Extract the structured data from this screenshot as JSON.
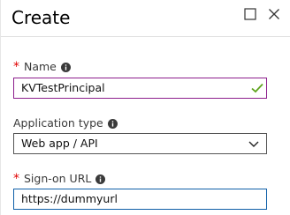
{
  "header": {
    "title": "Create",
    "maximize_icon": "square-icon",
    "close_icon": "close-icon"
  },
  "form": {
    "name": {
      "label": "Name",
      "required": true,
      "value": "KVTestPrincipal",
      "status_icon": "checkmark-icon"
    },
    "application_type": {
      "label": "Application type",
      "required": false,
      "selected": "Web app / API"
    },
    "sign_on_url": {
      "label": "Sign-on URL",
      "required": true,
      "value": "https://dummyurl"
    },
    "required_marker": "*"
  },
  "colors": {
    "required_asterisk": "#e00000",
    "valid_border": "#8c1e8c",
    "valid_check": "#5fa31e",
    "focus_border": "#0f5fa8"
  }
}
